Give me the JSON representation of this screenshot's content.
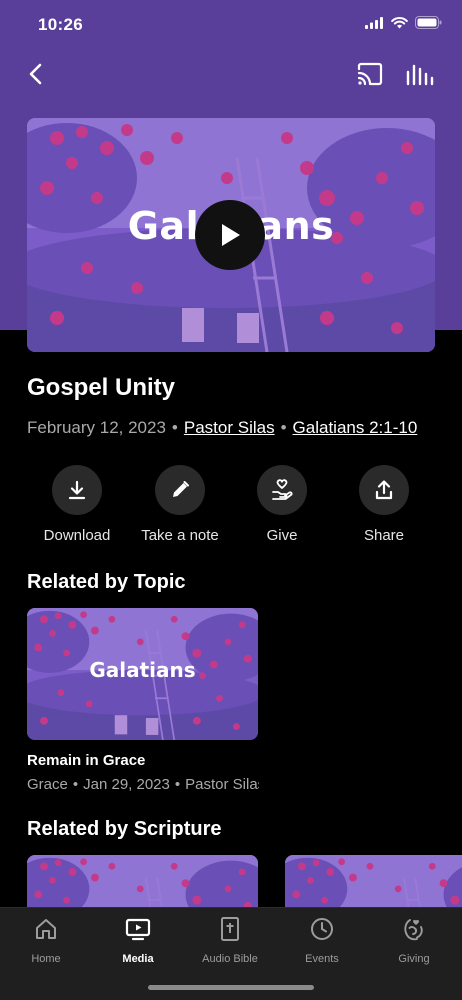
{
  "status": {
    "time": "10:26"
  },
  "hero": {
    "overlay_word": "Galatians"
  },
  "sermon": {
    "title": "Gospel Unity",
    "date": "February 12, 2023",
    "speaker": "Pastor Silas",
    "scripture": "Galatians 2:1-10"
  },
  "actions": [
    {
      "label": "Download",
      "icon": "download-icon"
    },
    {
      "label": "Take a note",
      "icon": "pencil-icon"
    },
    {
      "label": "Give",
      "icon": "give-icon"
    },
    {
      "label": "Share",
      "icon": "share-icon"
    }
  ],
  "related_topic": {
    "heading": "Related by Topic",
    "items": [
      {
        "overlay_word": "Galatians",
        "title": "Remain in Grace",
        "series": "Grace",
        "date": "Jan 29, 2023",
        "speaker": "Pastor Silas"
      }
    ]
  },
  "related_scripture": {
    "heading": "Related by Scripture"
  },
  "tabs": [
    {
      "label": "Home",
      "icon": "home-icon",
      "active": false
    },
    {
      "label": "Media",
      "icon": "media-icon",
      "active": true
    },
    {
      "label": "Audio Bible",
      "icon": "bible-icon",
      "active": false
    },
    {
      "label": "Events",
      "icon": "clock-icon",
      "active": false
    },
    {
      "label": "Giving",
      "icon": "giving-icon",
      "active": false
    }
  ],
  "colors": {
    "brand_purple": "#5a3f9a",
    "background": "#000000",
    "tabbar": "#1f1f1f"
  }
}
